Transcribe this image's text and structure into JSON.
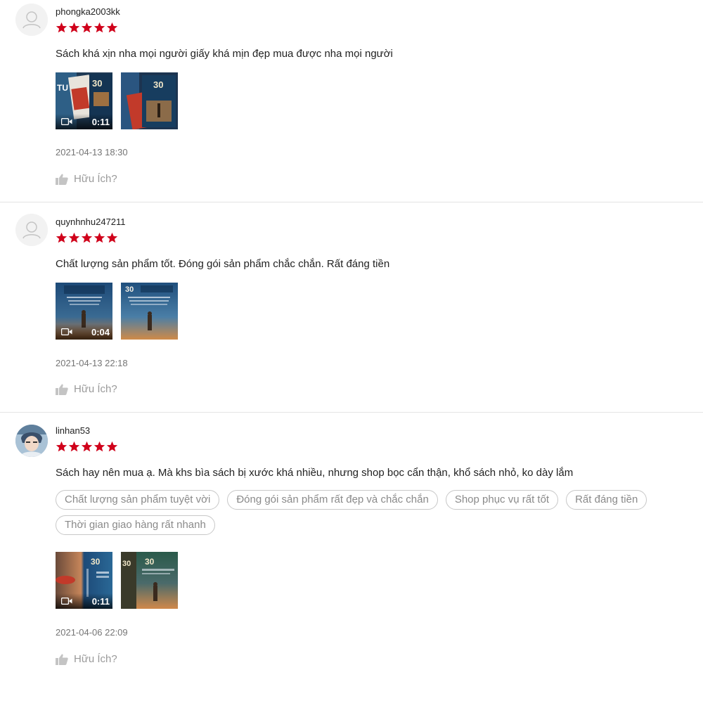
{
  "reviews": [
    {
      "username": "phongka2003kk",
      "rating": 5,
      "comment": "Sách khá xịn nha mọi người giấy khá mịn đẹp mua được nha mọi người",
      "video_duration": "0:11",
      "timestamp": "2021-04-13 18:30",
      "helpful_label": "Hữu Ích?"
    },
    {
      "username": "quynhnhu247211",
      "rating": 5,
      "comment": "Chất lượng sản phẩm tốt. Đóng gói sản phẩm chắc chắn. Rất đáng tiền",
      "video_duration": "0:04",
      "timestamp": "2021-04-13 22:18",
      "helpful_label": "Hữu Ích?"
    },
    {
      "username": "linhan53",
      "rating": 5,
      "comment": "Sách hay nên mua ạ. Mà khs bìa sách bị xước khá nhiều, nhưng shop bọc cẩn thận, khổ sách nhỏ, ko dày lắm",
      "tags": [
        "Chất lượng sản phẩm tuyệt vời",
        "Đóng gói sản phẩm rất đẹp và chắc chắn",
        "Shop phục vụ rất tốt",
        "Rất đáng tiền",
        "Thời gian giao hàng rất nhanh"
      ],
      "video_duration": "0:11",
      "timestamp": "2021-04-06 22:09",
      "helpful_label": "Hữu Ích?"
    }
  ],
  "colors": {
    "star": "#d0011b",
    "divider": "#e4e4e4",
    "muted_text": "#757575",
    "tag_border": "#c8c8c8"
  }
}
